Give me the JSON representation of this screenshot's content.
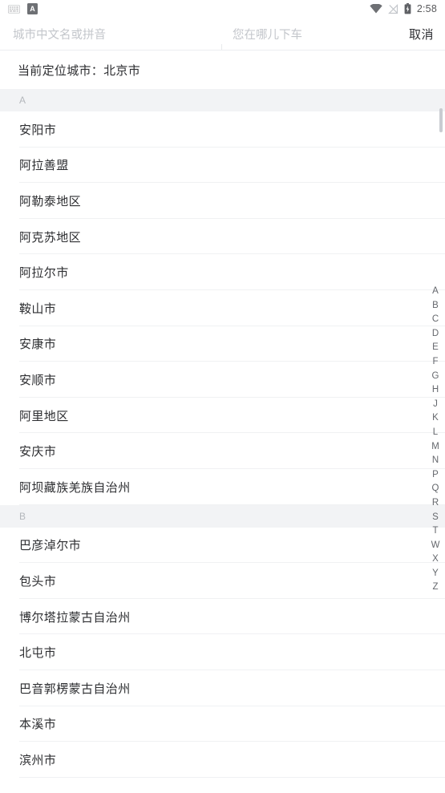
{
  "statusbar": {
    "icons_left": [
      "keyboard-icon",
      "a-badge-icon"
    ],
    "a_badge_label": "A",
    "icons_right": [
      "wifi-icon",
      "signal-off-icon",
      "battery-icon"
    ],
    "time": "2:58"
  },
  "searchbar": {
    "city_placeholder": "城市中文名或拼音",
    "city_value": "",
    "destination_placeholder": "您在哪儿下车",
    "destination_value": "",
    "cancel_label": "取消"
  },
  "located": {
    "label": "当前定位城市：北京市"
  },
  "sections": [
    {
      "letter": "A",
      "cities": [
        "安阳市",
        "阿拉善盟",
        "阿勒泰地区",
        "阿克苏地区",
        "阿拉尔市",
        "鞍山市",
        "安康市",
        "安顺市",
        "阿里地区",
        "安庆市",
        "阿坝藏族羌族自治州"
      ]
    },
    {
      "letter": "B",
      "cities": [
        "巴彦淖尔市",
        "包头市",
        "博尔塔拉蒙古自治州",
        "北屯市",
        "巴音郭楞蒙古自治州",
        "本溪市",
        "滨州市"
      ]
    }
  ],
  "index_bar": {
    "letters": [
      "A",
      "B",
      "C",
      "D",
      "E",
      "F",
      "G",
      "H",
      "J",
      "K",
      "L",
      "M",
      "N",
      "P",
      "Q",
      "R",
      "S",
      "T",
      "W",
      "X",
      "Y",
      "Z"
    ]
  },
  "colors": {
    "background": "#ffffff",
    "section_header_bg": "#f2f3f5",
    "text_primary": "#2d2e31",
    "text_muted": "#b4b7bc",
    "placeholder": "#c3c6cb",
    "divider": "#f0f1f3",
    "index_text": "#64676c",
    "scroll_thumb": "#c9ccd1"
  }
}
